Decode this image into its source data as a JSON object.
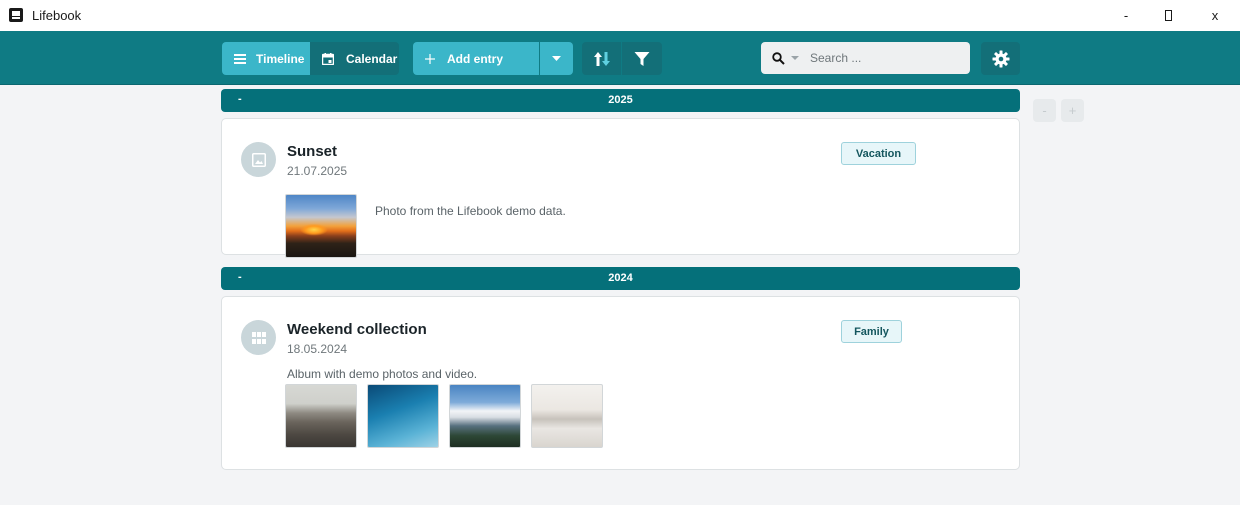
{
  "window": {
    "title": "Lifebook",
    "minimize": "-",
    "close": "x"
  },
  "toolbar": {
    "timeline_label": "Timeline",
    "calendar_label": "Calendar",
    "add_entry_label": "Add entry",
    "search_placeholder": "Search ...",
    "icons": {
      "timeline": "list-icon",
      "calendar": "calendar-icon",
      "add": "plus-icon",
      "add_dropdown": "chevron-down-icon",
      "sort": "sort-arrows-icon",
      "filter": "filter-icon",
      "search": "search-icon",
      "settings": "gear-icon"
    }
  },
  "zoom": {
    "out_label": "-",
    "in_label": "+"
  },
  "years": [
    {
      "collapse": "-",
      "year": "2025",
      "entries": [
        {
          "title": "Sunset",
          "date": "21.07.2025",
          "tag": "Vacation",
          "description": "Photo from the Lifebook demo data.",
          "icon": "image-icon"
        }
      ]
    },
    {
      "collapse": "-",
      "year": "2024",
      "entries": [
        {
          "title": "Weekend collection",
          "date": "18.05.2024",
          "tag": "Family",
          "description": "Album with demo photos and video.",
          "icon": "grid-icon"
        }
      ]
    }
  ],
  "colors": {
    "toolbar": "#0f7b84",
    "accent": "#3bb6c9",
    "year_bar": "#05707a"
  }
}
